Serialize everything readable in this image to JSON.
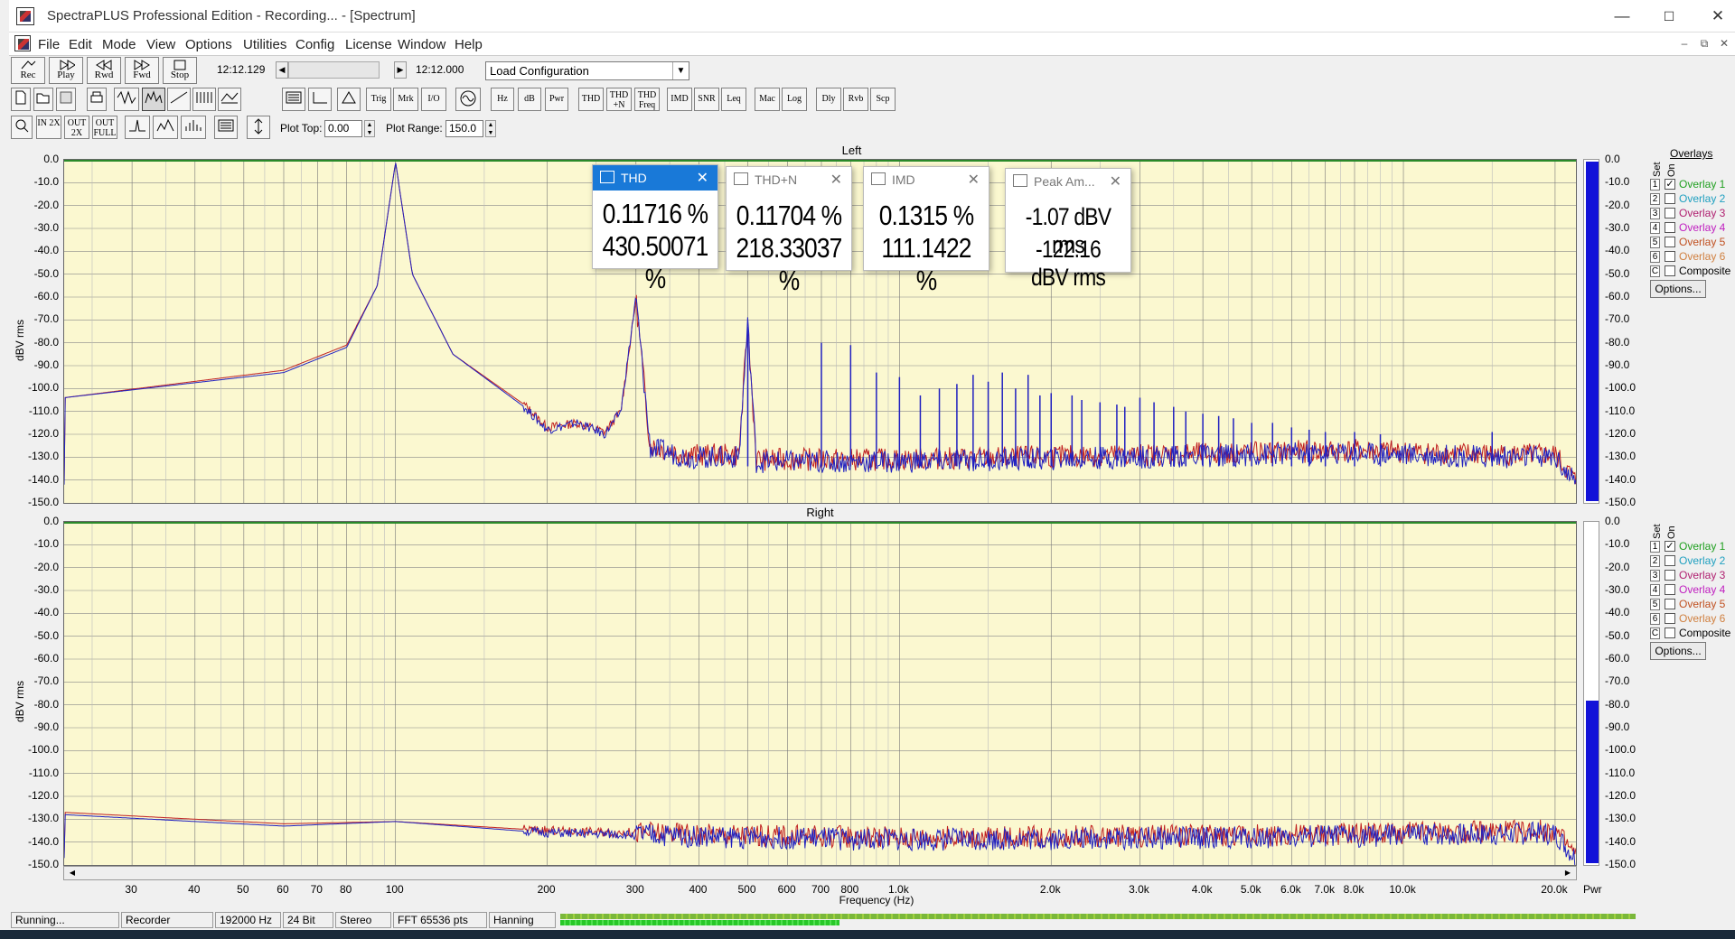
{
  "window": {
    "title": "SpectraPLUS Professional Edition - Recording... - [Spectrum]",
    "min": "—",
    "max": "☐",
    "close": "✕"
  },
  "menu": [
    "File",
    "Edit",
    "Mode",
    "View",
    "Options",
    "Utilities",
    "Config",
    "License",
    "Window",
    "Help"
  ],
  "mdi": {
    "min": "–",
    "restore": "⧉",
    "close": "✕"
  },
  "transport": {
    "rec": "Rec",
    "play": "Play",
    "rwd": "Rwd",
    "fwd": "Fwd",
    "stop": "Stop",
    "time_left": "12:12.129",
    "time_right": "12:12.000",
    "config": "Load Configuration"
  },
  "toolbar2": {
    "trig": "Trig",
    "mrk": "Mrk",
    "io": "I/O",
    "hz": "Hz",
    "db": "dB",
    "pwr": "Pwr",
    "thd": "THD",
    "thdn": "THD +N",
    "thdfreq": "THD Freq",
    "imd": "IMD",
    "snr": "SNR",
    "leq": "Leq",
    "mac": "Mac",
    "log": "Log",
    "dly": "Dly",
    "rvb": "Rvb",
    "scp": "Scp"
  },
  "toolbar3": {
    "in2x": "IN 2X",
    "out2x": "OUT 2X",
    "outfull": "OUT FULL",
    "plot_top_label": "Plot Top:",
    "plot_top": "0.00",
    "plot_range_label": "Plot Range:",
    "plot_range": "150.0"
  },
  "plot": {
    "y_ticks": [
      "0.0",
      "-10.0",
      "-20.0",
      "-30.0",
      "-40.0",
      "-50.0",
      "-60.0",
      "-70.0",
      "-80.0",
      "-90.0",
      "-100.0",
      "-110.0",
      "-120.0",
      "-130.0",
      "-140.0",
      "-150.0"
    ],
    "y_axis_label": "dBV rms",
    "x_ticks": [
      "30",
      "40",
      "50",
      "60",
      "70",
      "80",
      "100",
      "200",
      "300",
      "400",
      "500",
      "600",
      "700",
      "800",
      "1.0k",
      "2.0k",
      "3.0k",
      "4.0k",
      "5.0k",
      "6.0k",
      "7.0k",
      "8.0k",
      "10.0k",
      "20.0k"
    ],
    "x_axis_label": "Frequency (Hz)",
    "pwr_label": "Pwr",
    "left_title": "Left",
    "right_title": "Right"
  },
  "chart_data": [
    {
      "type": "line",
      "title": "Left",
      "xlabel": "Frequency (Hz)",
      "ylabel": "dBV rms",
      "xscale": "log",
      "xlim": [
        22,
        22000
      ],
      "ylim": [
        -150,
        0
      ],
      "series": [
        {
          "color": "#2020c0",
          "x": [
            22,
            60,
            80,
            92,
            100,
            108,
            130,
            180,
            200,
            230,
            260,
            280,
            300,
            320,
            380,
            480,
            500,
            520,
            1000,
            3000,
            8000,
            15000,
            20000,
            22000
          ],
          "y": [
            -104,
            -93,
            -82,
            -55,
            -1,
            -50,
            -85,
            -108,
            -118,
            -115,
            -120,
            -110,
            -60,
            -126,
            -130,
            -130,
            -72,
            -132,
            -132,
            -130,
            -128,
            -130,
            -130,
            -142
          ]
        },
        {
          "color": "#c02020",
          "x": [
            22,
            60,
            80,
            92,
            100,
            108,
            130,
            180,
            200,
            230,
            260,
            280,
            300,
            320,
            380,
            480,
            500,
            520,
            1000,
            3000,
            8000,
            15000,
            20000,
            22000
          ],
          "y": [
            -104,
            -92,
            -81,
            -55,
            -1,
            -50,
            -85,
            -107,
            -117,
            -115,
            -119,
            -110,
            -61,
            -125,
            -129,
            -129,
            -73,
            -131,
            -131,
            -129,
            -127,
            -129,
            -129,
            -141
          ]
        }
      ]
    },
    {
      "type": "line",
      "title": "Right",
      "xlabel": "Frequency (Hz)",
      "ylabel": "dBV rms",
      "xscale": "log",
      "xlim": [
        22,
        22000
      ],
      "ylim": [
        -150,
        0
      ],
      "series": [
        {
          "color": "#2020c0",
          "x": [
            22,
            40,
            60,
            100,
            200,
            500,
            1000,
            5000,
            20000,
            22000
          ],
          "y": [
            -128,
            -131,
            -133,
            -131,
            -136,
            -138,
            -139,
            -138,
            -136,
            -147
          ]
        },
        {
          "color": "#c02020",
          "x": [
            22,
            40,
            60,
            100,
            200,
            500,
            1000,
            5000,
            20000,
            22000
          ],
          "y": [
            -127,
            -130,
            -132,
            -131,
            -135,
            -137,
            -138,
            -137,
            -135,
            -146
          ]
        }
      ]
    }
  ],
  "meters": {
    "left_level": 100,
    "right_level": 48
  },
  "overlays": {
    "title": "Overlays",
    "set_label": "Set",
    "on_label": "On",
    "items": [
      {
        "num": "1",
        "name": "Overlay 1",
        "color": "#20a020",
        "checked": "✓"
      },
      {
        "num": "2",
        "name": "Overlay 2",
        "color": "#20a0c0",
        "checked": ""
      },
      {
        "num": "3",
        "name": "Overlay 3",
        "color": "#b02070",
        "checked": ""
      },
      {
        "num": "4",
        "name": "Overlay 4",
        "color": "#c020c0",
        "checked": ""
      },
      {
        "num": "5",
        "name": "Overlay 5",
        "color": "#c05020",
        "checked": ""
      },
      {
        "num": "6",
        "name": "Overlay 6",
        "color": "#d08040",
        "checked": ""
      },
      {
        "num": "C",
        "name": "Composite",
        "color": "#000000",
        "checked": ""
      }
    ],
    "options": "Options..."
  },
  "measurements": [
    {
      "title": "THD",
      "v1": "0.11716 %",
      "v2": "430.50071 %"
    },
    {
      "title": "THD+N",
      "v1": "0.11704 %",
      "v2": "218.33037 %"
    },
    {
      "title": "IMD",
      "v1": "0.1315 %",
      "v2": "111.1422 %"
    },
    {
      "title": "Peak Am...",
      "v1": "-1.07 dBV rms",
      "v2": "-122.16 dBV rms"
    }
  ],
  "status": {
    "state": "Running...",
    "mode": "Recorder",
    "rate": "192000 Hz",
    "bits": "24 Bit",
    "channels": "Stereo",
    "fft": "FFT 65536 pts",
    "window": "Hanning"
  },
  "status_progress": 0.26
}
